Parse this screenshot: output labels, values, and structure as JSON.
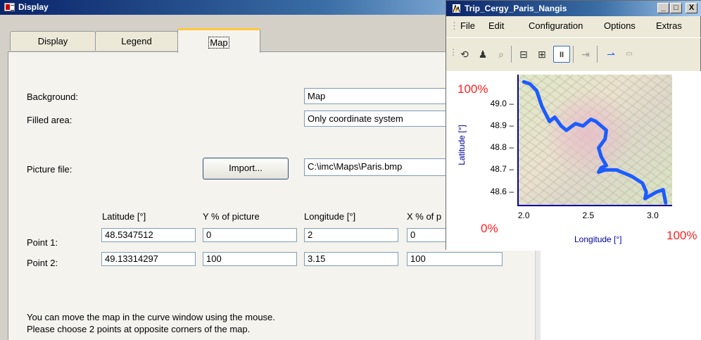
{
  "dialog": {
    "title": "Display",
    "tabs": [
      {
        "label": "Display"
      },
      {
        "label": "Legend"
      },
      {
        "label": "Map"
      }
    ],
    "background_label": "Background:",
    "background_value": "Map",
    "filled_area_label": "Filled area:",
    "filled_area_value": "Only coordinate system",
    "picture_file_label": "Picture file:",
    "import_button": "Import...",
    "picture_file_value": "C:\\imc\\Maps\\Paris.bmp",
    "columns": [
      "Latitude [°]",
      "Y % of picture",
      "Longitude [°]",
      "X % of p"
    ],
    "points": [
      {
        "label": "Point 1:",
        "latitude": "48.5347512",
        "y_percent": "0",
        "longitude": "2",
        "x_percent": "0"
      },
      {
        "label": "Point 2:",
        "latitude": "49.13314297",
        "y_percent": "100",
        "longitude": "3.15",
        "x_percent": "100"
      }
    ],
    "hint_line1": "You can move the map in the curve window using the mouse.",
    "hint_line2": "Please choose 2 points at opposite corners of the map."
  },
  "curve_window": {
    "title": "Trip_Cergy_Paris_Nangis",
    "window_buttons": [
      "_",
      "□",
      "X"
    ],
    "menu": [
      "File",
      "Edit",
      "Configuration",
      "Options",
      "Extras"
    ],
    "toolbar_icons": [
      "reset-zoom-icon",
      "persons-icon",
      "zoom-icon",
      "copy-curve-icon",
      "paste-curve-icon",
      "pause-icon",
      "cursor-icon",
      "measure-icon",
      "grid-icon"
    ],
    "label_100_left": "100%",
    "label_0": "0%",
    "label_100_right": "100%"
  },
  "chart_data": {
    "type": "line",
    "xlabel": "Longitude [°]",
    "ylabel": "Latitude [°]",
    "xlim": [
      1.95,
      3.15
    ],
    "ylim": [
      48.535,
      49.133
    ],
    "xticks": [
      "2.0",
      "2.5",
      "3.0"
    ],
    "yticks": [
      "49.0",
      "48.9",
      "48.8",
      "48.7",
      "48.6"
    ],
    "series": [
      {
        "color": "#1c5cff",
        "x": [
          2.0,
          2.05,
          2.1,
          2.14,
          2.2,
          2.24,
          2.29,
          2.33,
          2.4,
          2.46,
          2.52,
          2.56,
          2.6,
          2.64,
          2.63,
          2.58,
          2.6,
          2.64,
          2.6,
          2.58,
          2.63,
          2.72,
          2.84,
          2.92,
          2.95,
          2.94,
          2.97,
          3.03,
          3.08,
          3.1
        ],
        "y": [
          49.1,
          49.09,
          49.06,
          48.99,
          48.92,
          48.94,
          48.9,
          48.88,
          48.91,
          48.9,
          48.93,
          48.92,
          48.9,
          48.88,
          48.84,
          48.8,
          48.76,
          48.72,
          48.71,
          48.69,
          48.7,
          48.7,
          48.67,
          48.64,
          48.6,
          48.57,
          48.58,
          48.6,
          48.61,
          48.55
        ]
      }
    ]
  }
}
